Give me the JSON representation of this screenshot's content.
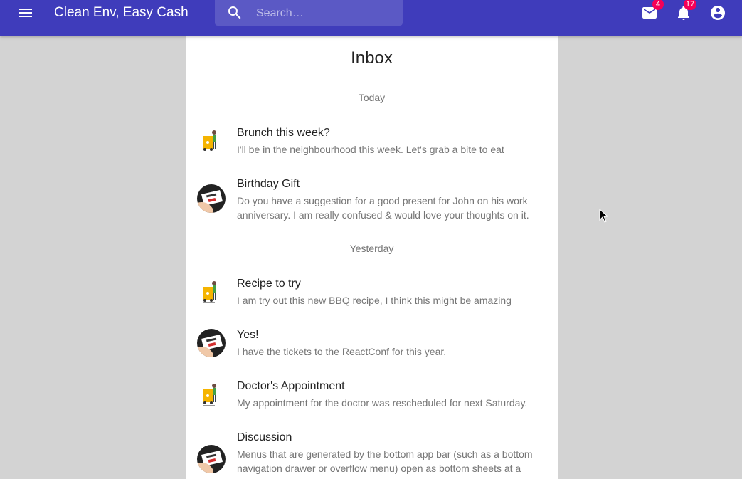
{
  "appbar": {
    "title": "Clean Env, Easy Cash",
    "search_placeholder": "Search…",
    "mail_badge": "4",
    "notifications_badge": "17",
    "color": "#3f3cbb",
    "badge_color": "#f50057",
    "icons": {
      "menu": "menu-icon",
      "search": "search-icon",
      "mail": "mail-icon",
      "notifications": "bell-icon",
      "account": "account-circle-icon"
    }
  },
  "inbox": {
    "title": "Inbox",
    "subheaders": [
      "Today",
      "Yesterday"
    ],
    "messages": [
      {
        "primary": "Brunch this week?",
        "secondary": "I'll be in the neighbourhood this week. Let's grab a bite to eat",
        "avatar": "delivery-avatar"
      },
      {
        "primary": "Birthday Gift",
        "secondary": "Do you have a suggestion for a good present for John on his work anniversary. I am really confused & would love your thoughts on it.",
        "avatar": "we-want-you-avatar"
      },
      {
        "primary": "Recipe to try",
        "secondary": "I am try out this new BBQ recipe, I think this might be amazing",
        "avatar": "delivery-avatar"
      },
      {
        "primary": "Yes!",
        "secondary": "I have the tickets to the ReactConf for this year.",
        "avatar": "we-want-you-avatar"
      },
      {
        "primary": "Doctor's Appointment",
        "secondary": "My appointment for the doctor was rescheduled for next Saturday.",
        "avatar": "delivery-avatar"
      },
      {
        "primary": "Discussion",
        "secondary": "Menus that are generated by the bottom app bar (such as a bottom navigation drawer or overflow menu) open as bottom sheets at a higher elevation than the bar.",
        "avatar": "we-want-you-avatar"
      }
    ]
  }
}
